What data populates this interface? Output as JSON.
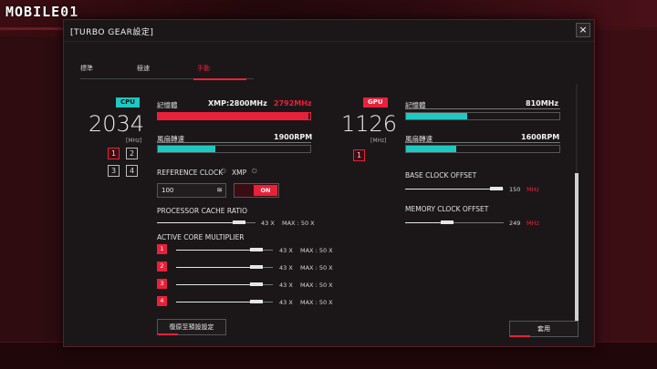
{
  "watermark": "MOBILE01",
  "dialog": {
    "title": "[TURBO GEAR設定]",
    "close": "×",
    "tabs": [
      "標準",
      "極速",
      "手動"
    ],
    "active_tab": 2
  },
  "cpu": {
    "badge": "CPU",
    "clock": "2034",
    "unit": "[MHz]",
    "profiles": [
      "1",
      "2",
      "3",
      "4"
    ],
    "memory_label": "記憶體",
    "memory_value": "XMP:2800MHz",
    "memory_value_red": "2792MHz",
    "memory_fill": 0.99,
    "fan_label": "風扇轉速",
    "fan_value": "1900RPM",
    "fan_fill": 0.38,
    "ref_clock_label": "REFERENCE CLOCK",
    "xmp_label": "XMP",
    "ref_clock_value": "100",
    "xmp_toggle": "ON",
    "cache_label": "PROCESSOR CACHE RATIO",
    "cache_value": "43 X",
    "cache_max": "MAX : 50 X",
    "cache_fill": 0.86,
    "core_label": "ACTIVE CORE MULTIPLIER",
    "cores": [
      {
        "id": "1",
        "value": "43 X",
        "max": "MAX : 50 X",
        "fill": 0.86
      },
      {
        "id": "2",
        "value": "43 X",
        "max": "MAX : 50 X",
        "fill": 0.86
      },
      {
        "id": "3",
        "value": "43 X",
        "max": "MAX : 50 X",
        "fill": 0.86
      },
      {
        "id": "4",
        "value": "43 X",
        "max": "MAX : 50 X",
        "fill": 0.86
      }
    ]
  },
  "gpu": {
    "badge": "GPU",
    "clock": "1126",
    "unit": "[MHz]",
    "profile": "1",
    "memory_label": "記憶體",
    "memory_value": "810MHz",
    "memory_fill": 0.4,
    "fan_label": "風扇轉速",
    "fan_value": "1600RPM",
    "fan_fill": 0.33,
    "base_label": "BASE CLOCK OFFSET",
    "base_value": "150",
    "base_unit": "MHz",
    "base_fill": 0.95,
    "mem_offset_label": "MEMORY CLOCK OFFSET",
    "mem_offset_value": "249",
    "mem_offset_unit": "MHz",
    "mem_offset_fill": 0.45
  },
  "buttons": {
    "restore": "復原至預設設定",
    "apply": "套用"
  }
}
